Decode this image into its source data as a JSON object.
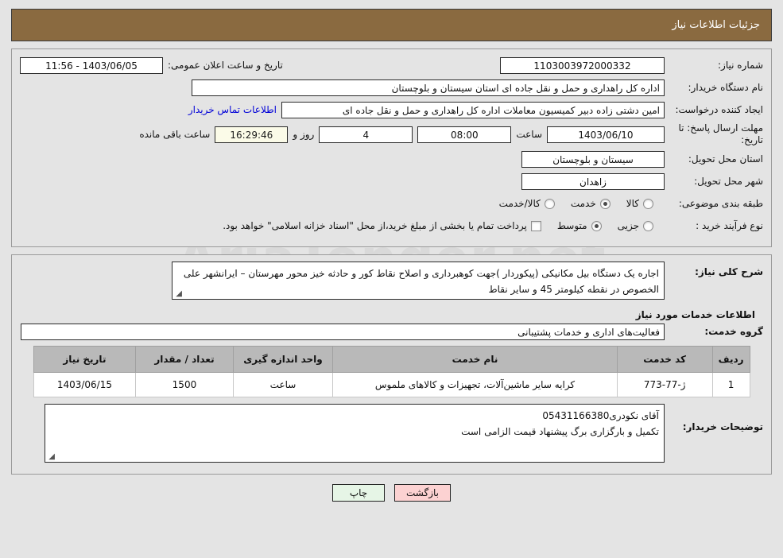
{
  "header": {
    "title": "جزئیات اطلاعات نیاز"
  },
  "form": {
    "need_number_label": "شماره نیاز:",
    "need_number_value": "1103003972000332",
    "public_announce_label": "تاریخ و ساعت اعلان عمومی:",
    "public_announce_value": "1403/06/05 - 11:56",
    "buyer_org_label": "نام دستگاه خریدار:",
    "buyer_org_value": "اداره کل راهداری و حمل و نقل جاده ای استان سیستان و بلوچستان",
    "creator_label": "ایجاد کننده درخواست:",
    "creator_value": "امین دشتی زاده دبیر کمیسیون معاملات اداره کل راهداری و حمل و نقل جاده ای",
    "buyer_contact_link": "اطلاعات تماس خریدار",
    "deadline_label": "مهلت ارسال پاسخ: تا تاریخ:",
    "deadline_date": "1403/06/10",
    "hour_label": "ساعت",
    "hour_value": "08:00",
    "days_value": "4",
    "days_label": "روز و",
    "countdown_value": "16:29:46",
    "countdown_label": "ساعت باقی مانده",
    "province_label": "استان محل تحویل:",
    "province_value": "سیستان و بلوچستان",
    "city_label": "شهر محل تحویل:",
    "city_value": "زاهدان",
    "category_label": "طبقه بندی موضوعی:",
    "category_options": [
      {
        "label": "کالا",
        "selected": false
      },
      {
        "label": "خدمت",
        "selected": true
      },
      {
        "label": "کالا/خدمت",
        "selected": false
      }
    ],
    "process_label": "نوع فرآیند خرید :",
    "process_options": [
      {
        "label": "جزیی",
        "selected": false
      },
      {
        "label": "متوسط",
        "selected": true
      }
    ],
    "treasury_checkbox_checked": false,
    "treasury_text": "پرداخت تمام یا بخشی از مبلغ خرید،از محل \"اسناد خزانه اسلامی\" خواهد بود."
  },
  "description": {
    "label": "شرح کلی نیاز:",
    "value": "اجاره یک دستگاه بیل مکانیکی (پیکوردار )جهت کوهبرداری و اصلاح نقاط کور و حادثه خیز محور مهرستان – ایرانشهر علی الخصوص در نقطه کیلومتر 45 و سایر نقاط"
  },
  "services": {
    "section_title": "اطلاعات خدمات مورد نیاز",
    "group_label": "گروه خدمت:",
    "group_value": "فعالیت‌های اداری و خدمات پشتیبانی",
    "columns": [
      "ردیف",
      "کد خدمت",
      "نام خدمت",
      "واحد اندازه گیری",
      "تعداد / مقدار",
      "تاریخ نیاز"
    ],
    "rows": [
      {
        "row_no": "1",
        "code": "ژ-77-773",
        "name": "کرایه سایر ماشین‌آلات، تجهیزات و کالاهای ملموس",
        "unit": "ساعت",
        "qty": "1500",
        "date": "1403/06/15"
      }
    ]
  },
  "notes": {
    "label": "توضیحات خریدار:",
    "line1": "آقای نکودری05431166380",
    "line2": "تکمیل و بارگزاری برگ پیشنهاد قیمت الزامی است"
  },
  "footer": {
    "print_label": "چاپ",
    "back_label": "بازگشت"
  },
  "watermark": {
    "text": "AriaTender.net"
  },
  "colors": {
    "header_bg": "#8a6a40",
    "page_bg": "#e4e4e4",
    "link": "#0000d8",
    "countdown_bg": "#fbfbe8",
    "table_header_bg": "#b9b9b9",
    "print_btn_bg": "#e6f5e6",
    "back_btn_bg": "#fcd2d2"
  }
}
